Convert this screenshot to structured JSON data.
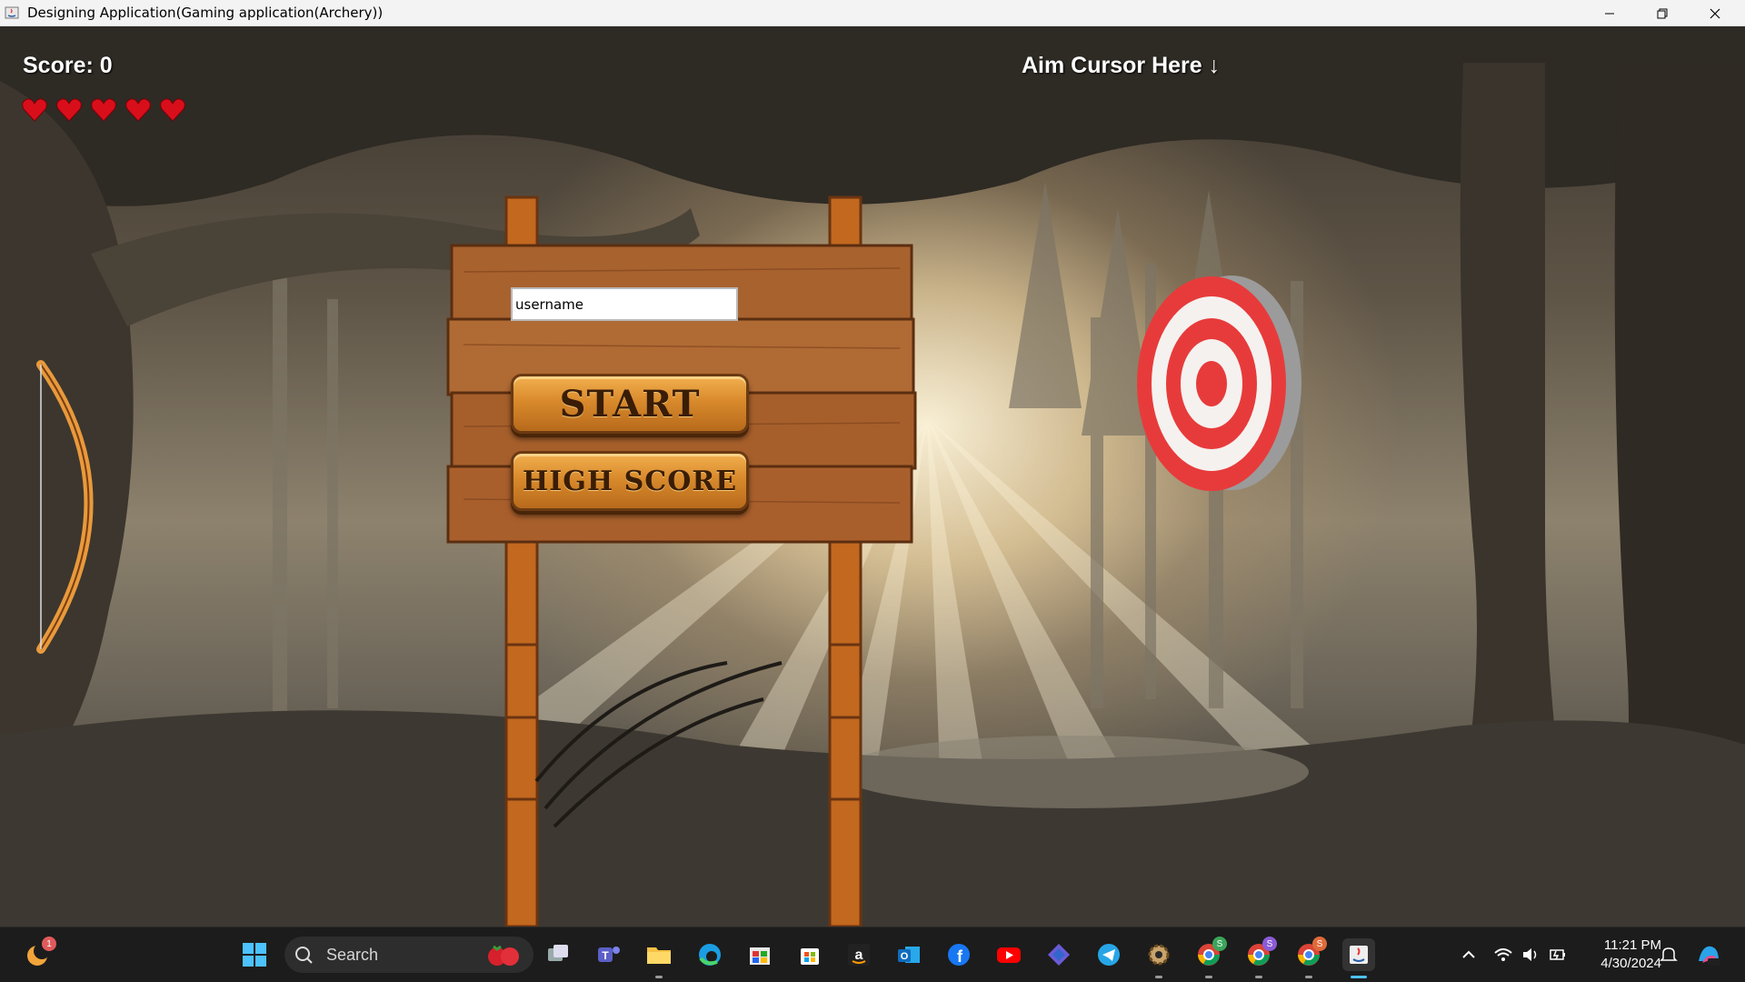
{
  "window": {
    "title": "Designing Application(Gaming application(Archery))",
    "controls": [
      "minimize",
      "restore",
      "close"
    ]
  },
  "game": {
    "score_text": "Score: 0",
    "lives": 5,
    "aim_hint": "Aim Cursor Here ↓",
    "username_value": "username",
    "start_label": "START",
    "highscore_label": "HIGH SCORE"
  },
  "taskbar": {
    "widget_badge": "1",
    "search_label": "Search",
    "pinned_icons": [
      "windows-start-icon",
      "search-icon",
      "task-view-icon",
      "teams-icon",
      "file-explorer-icon",
      "edge-icon",
      "store-icon",
      "microsoft-store-icon",
      "amazon-icon",
      "outlook-icon",
      "facebook-icon",
      "youtube-icon",
      "copilot-icon",
      "telegram-icon",
      "settings-icon",
      "chrome-icon",
      "chrome-icon",
      "chrome-icon",
      "java-icon"
    ],
    "chrome_badges": [
      "S",
      "S",
      "S"
    ],
    "time": "11:21 PM",
    "date": "4/30/2024"
  },
  "colors": {
    "hud_text": "#ffffff",
    "heart": "#d80f1b",
    "button_wood": "#d98a2c",
    "taskbar": "#1c1c1c",
    "active_indicator": "#4cc2ff"
  }
}
